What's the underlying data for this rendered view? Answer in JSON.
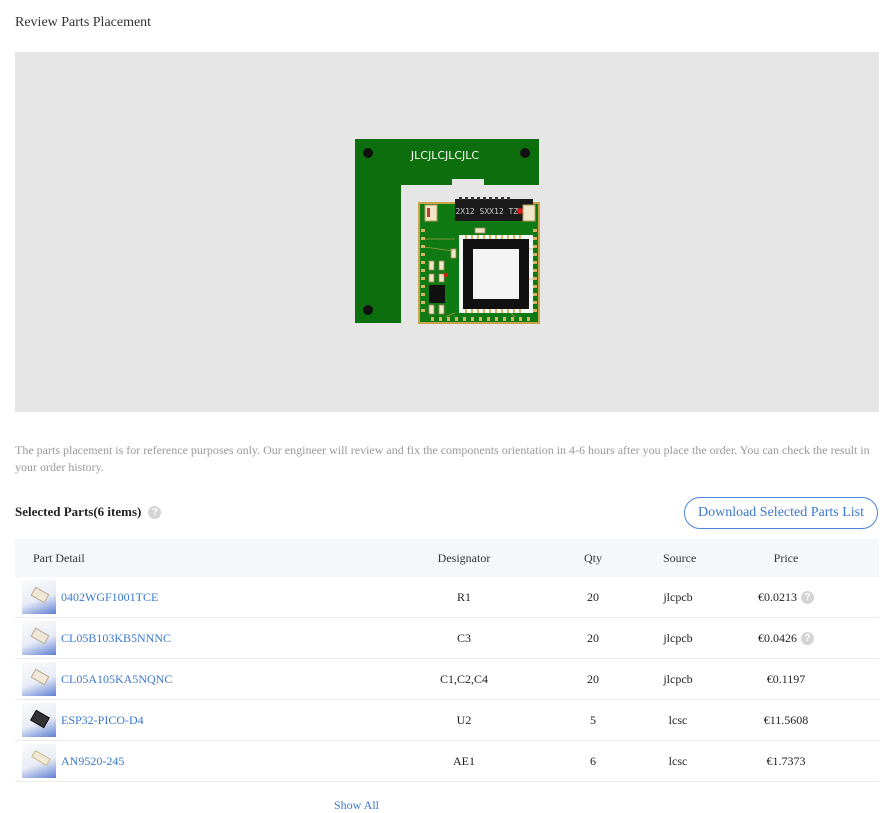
{
  "section_title": "Review Parts Placement",
  "pcb": {
    "silkscreen": "JLCJLCJLCJLC",
    "chip_marking": "2X12 SXX12 TZ 7M",
    "board_color": "#0d6e0d",
    "background_color": "#e6e6e6"
  },
  "notice": "The parts placement is for reference purposes only. Our engineer will review and fix the components orientation in 4-6 hours after you place the order. You can check the result in your order history.",
  "parts": {
    "title": "Selected Parts(6 items)",
    "help_icon": "question-circle-icon",
    "download_label": "Download Selected Parts List",
    "columns": [
      "Part Detail",
      "Designator",
      "Qty",
      "Source",
      "Price"
    ],
    "rows": [
      {
        "part": "0402WGF1001TCE",
        "designator": "R1",
        "qty": "20",
        "source": "jlcpcb",
        "price": "€0.0213",
        "has_help": true,
        "thumb": "resistor-thumbnail"
      },
      {
        "part": "CL05B103KB5NNNC",
        "designator": "C3",
        "qty": "20",
        "source": "jlcpcb",
        "price": "€0.0426",
        "has_help": true,
        "thumb": "capacitor-thumbnail"
      },
      {
        "part": "CL05A105KA5NQNC",
        "designator": "C1,C2,C4",
        "qty": "20",
        "source": "jlcpcb",
        "price": "€0.1197",
        "has_help": false,
        "thumb": "capacitor-thumbnail"
      },
      {
        "part": "ESP32-PICO-D4",
        "designator": "U2",
        "qty": "5",
        "source": "lcsc",
        "price": "€11.5608",
        "has_help": false,
        "thumb": "ic-thumbnail"
      },
      {
        "part": "AN9520-245",
        "designator": "AE1",
        "qty": "6",
        "source": "lcsc",
        "price": "€1.7373",
        "has_help": false,
        "thumb": "antenna-thumbnail"
      }
    ],
    "show_all": "Show All"
  }
}
